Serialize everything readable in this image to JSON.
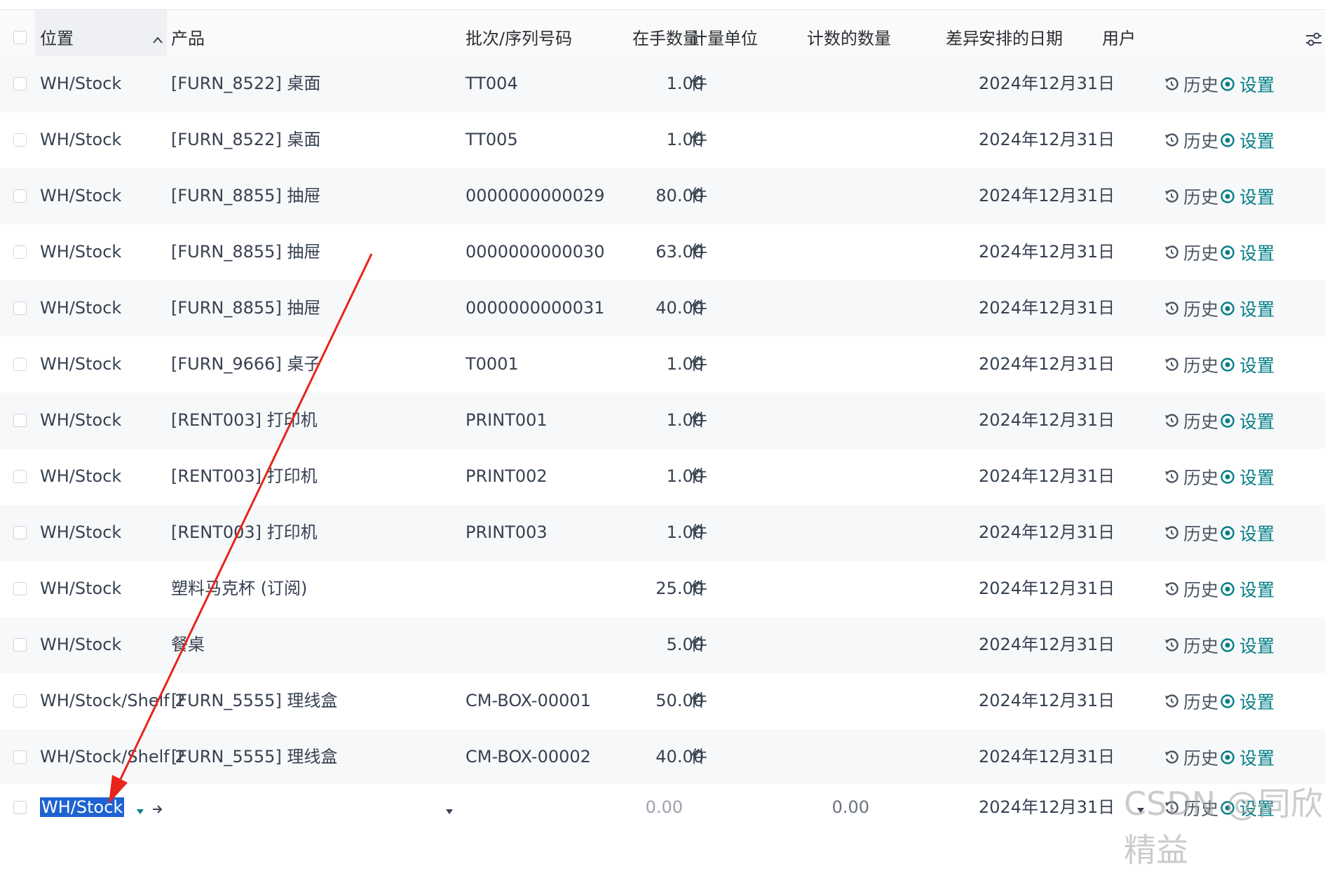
{
  "header": {
    "location": "位置",
    "product": "产品",
    "lot": "批次/序列号码",
    "onhand": "在手数量",
    "uom": "计量单位",
    "counted": "计数的数量",
    "diff": "差异",
    "date": "安排的日期",
    "user": "用户",
    "sort_icon": "chevron-up-icon",
    "settings_icon": "sliders-icon"
  },
  "actions": {
    "history": "历史",
    "set": "设置"
  },
  "rows": [
    {
      "location": "WH/Stock",
      "product": "[FURN_8522] 桌面",
      "lot": "TT004",
      "qty": "1.00",
      "uom": "件",
      "date": "2024年12月31日"
    },
    {
      "location": "WH/Stock",
      "product": "[FURN_8522] 桌面",
      "lot": "TT005",
      "qty": "1.00",
      "uom": "件",
      "date": "2024年12月31日"
    },
    {
      "location": "WH/Stock",
      "product": "[FURN_8855] 抽屉",
      "lot": "0000000000029",
      "qty": "80.00",
      "uom": "件",
      "date": "2024年12月31日"
    },
    {
      "location": "WH/Stock",
      "product": "[FURN_8855] 抽屉",
      "lot": "0000000000030",
      "qty": "63.00",
      "uom": "件",
      "date": "2024年12月31日"
    },
    {
      "location": "WH/Stock",
      "product": "[FURN_8855] 抽屉",
      "lot": "0000000000031",
      "qty": "40.00",
      "uom": "件",
      "date": "2024年12月31日"
    },
    {
      "location": "WH/Stock",
      "product": "[FURN_9666] 桌子",
      "lot": "T0001",
      "qty": "1.00",
      "uom": "件",
      "date": "2024年12月31日"
    },
    {
      "location": "WH/Stock",
      "product": "[RENT003] 打印机",
      "lot": "PRINT001",
      "qty": "1.00",
      "uom": "件",
      "date": "2024年12月31日"
    },
    {
      "location": "WH/Stock",
      "product": "[RENT003] 打印机",
      "lot": "PRINT002",
      "qty": "1.00",
      "uom": "件",
      "date": "2024年12月31日"
    },
    {
      "location": "WH/Stock",
      "product": "[RENT003] 打印机",
      "lot": "PRINT003",
      "qty": "1.00",
      "uom": "件",
      "date": "2024年12月31日"
    },
    {
      "location": "WH/Stock",
      "product": "塑料马克杯 (订阅)",
      "lot": "",
      "qty": "25.00",
      "uom": "件",
      "date": "2024年12月31日"
    },
    {
      "location": "WH/Stock",
      "product": "餐桌",
      "lot": "",
      "qty": "5.00",
      "uom": "件",
      "date": "2024年12月31日"
    },
    {
      "location": "WH/Stock/Shelf 2",
      "product": "[FURN_5555] 理线盒",
      "lot": "CM-BOX-00001",
      "qty": "50.00",
      "uom": "件",
      "date": "2024年12月31日"
    },
    {
      "location": "WH/Stock/Shelf 2",
      "product": "[FURN_5555] 理线盒",
      "lot": "CM-BOX-00002",
      "qty": "40.00",
      "uom": "件",
      "date": "2024年12月31日"
    }
  ],
  "edit_row": {
    "location": "WH/Stock",
    "qty": "0.00",
    "counted": "0.00",
    "date": "2024年12月31日"
  },
  "watermark": "CSDN @同欣精益",
  "colors": {
    "accent": "#017e84",
    "selection": "#1e63d1",
    "annotation_arrow": "#e8241b"
  }
}
